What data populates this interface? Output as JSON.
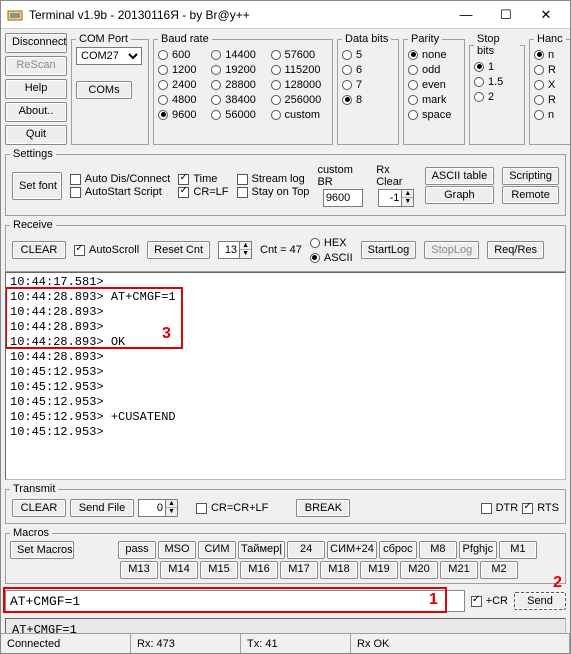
{
  "window": {
    "title": "Terminal v1.9b - 20130116Я - by Br@y++",
    "min": "—",
    "max": "☐",
    "close": "✕"
  },
  "left_buttons": [
    "Disconnect",
    "ReScan",
    "Help",
    "About..",
    "Quit"
  ],
  "comport": {
    "legend": "COM Port",
    "value": "COM27",
    "btn": "COMs"
  },
  "baud": {
    "legend": "Baud rate",
    "cols": [
      [
        "600",
        "1200",
        "2400",
        "4800",
        "9600"
      ],
      [
        "14400",
        "19200",
        "28800",
        "38400",
        "56000"
      ],
      [
        "57600",
        "115200",
        "128000",
        "256000",
        "custom"
      ]
    ],
    "selected": "9600"
  },
  "databits": {
    "legend": "Data bits",
    "opts": [
      "5",
      "6",
      "7",
      "8"
    ],
    "selected": "8"
  },
  "parity": {
    "legend": "Parity",
    "opts": [
      "none",
      "odd",
      "even",
      "mark",
      "space"
    ],
    "selected": "none"
  },
  "stopbits": {
    "legend": "Stop bits",
    "opts": [
      "1",
      "1.5",
      "2"
    ],
    "selected": "1"
  },
  "handshake": {
    "legend": "Hanc",
    "opts": [
      "n",
      "R",
      "X",
      "R",
      "n"
    ],
    "selected": "n"
  },
  "settings": {
    "legend": "Settings",
    "setfont": "Set font",
    "auto_dc": "Auto Dis/Connect",
    "autostart": "AutoStart Script",
    "time": "Time",
    "crlf": "CR=LF",
    "streamlog": "Stream log",
    "stayontop": "Stay on Top",
    "custombr_label": "custom BR",
    "custombr": "9600",
    "rx_clear": "Rx Clear",
    "rx_clear_val": "-1",
    "ascii_table": "ASCII table",
    "graph": "Graph",
    "scripting": "Scripting",
    "remote": "Remote"
  },
  "receive": {
    "legend": "Receive",
    "clear": "CLEAR",
    "autoscroll": "AutoScroll",
    "reset": "Reset Cnt",
    "reset_val": "13",
    "cnt_label": "Cnt =",
    "cnt_val": "47",
    "hex": "HEX",
    "ascii": "ASCII",
    "startlog": "StartLog",
    "stoplog": "StopLog",
    "reqres": "Req/Res",
    "lines": [
      "10:44:17.581>",
      "10:44:28.893> AT+CMGF=1",
      "10:44:28.893>",
      "10:44:28.893>",
      "10:44:28.893> OK",
      "10:44:28.893>",
      "10:45:12.953>",
      "10:45:12.953>",
      "10:45:12.953>",
      "10:45:12.953> +CUSATEND",
      "10:45:12.953>"
    ]
  },
  "transmit": {
    "legend": "Transmit",
    "clear": "CLEAR",
    "sendfile": "Send File",
    "spin": "0",
    "crcrlf": "CR=CR+LF",
    "break": "BREAK",
    "dtr": "DTR",
    "rts": "RTS"
  },
  "macros": {
    "legend": "Macros",
    "set": "Set Macros",
    "row1": [
      "pass",
      "MSO",
      "СИМ",
      "Таймер|",
      "24",
      "СИМ+24",
      "сброс",
      "M8",
      "Pfghjc",
      "M1"
    ],
    "row2": [
      "M13",
      "M14",
      "M15",
      "M16",
      "M17",
      "M18",
      "M19",
      "M20",
      "M21",
      "M2"
    ]
  },
  "send": {
    "value": "AT+CMGF=1",
    "cr": "+CR",
    "btn": "Send",
    "out": "AT+CMGF=1"
  },
  "status": {
    "conn": "Connected",
    "rx": "Rx: 473",
    "tx": "Tx: 41",
    "rxok": "Rx OK"
  },
  "annot": {
    "n1": "1",
    "n2": "2",
    "n3": "3"
  }
}
